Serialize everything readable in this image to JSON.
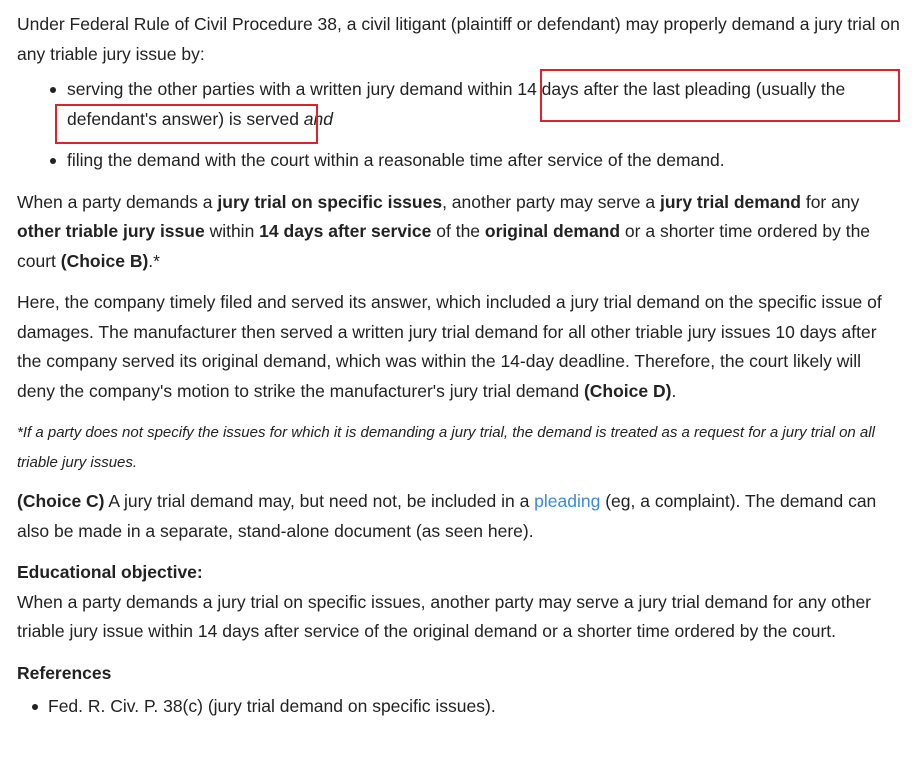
{
  "intro": "Under Federal Rule of Civil Procedure 38, a civil litigant (plaintiff or defendant) may properly demand a jury trial on any triable jury issue by:",
  "bullets": {
    "b1_text": "serving the other parties with a written jury demand within 14 days after the last pleading (usually the defendant's answer) is served ",
    "b1_and": "and",
    "b2_text": "filing the demand with the court within a reasonable time after service of the demand."
  },
  "para1": {
    "t1": "When a party demands a ",
    "b1": "jury trial on specific issues",
    "t2": ", another party may serve a ",
    "b2": "jury trial demand",
    "t3": " for any ",
    "b3": "other triable jury issue",
    "t4": " within ",
    "b4": "14 days after service",
    "t5": " of the ",
    "b5": "original demand",
    "t6": " or a shorter time ordered by the court ",
    "b6": "(Choice B)",
    "t7": ".*"
  },
  "para2": {
    "text": "Here, the company timely filed and served its answer, which included a jury trial demand on the specific issue of damages.  The manufacturer then served a written jury trial demand for all other triable jury issues 10 days after the company served its original demand, which was within the 14-day deadline.  Therefore, the court likely will deny the company's motion to strike the manufacturer's jury trial demand ",
    "choice": "(Choice D)",
    "end": "."
  },
  "footnote": "*If a party does not specify the issues for which it is demanding a jury trial, the demand is treated as a request for a jury trial on all triable jury issues.",
  "para3": {
    "choice": "(Choice C)",
    "t1": "  A jury trial demand may, but need not, be included in a ",
    "link": "pleading",
    "t2": " (eg, a complaint).  The demand can also be made in a separate, stand-alone document (as seen here)."
  },
  "objective": {
    "title": "Educational objective:",
    "text": "When a party demands a jury trial on specific issues, another party may serve a jury trial demand for any other triable jury issue within 14 days after service of the original demand or a shorter time ordered by the court."
  },
  "references": {
    "title": "References",
    "items": [
      "Fed. R. Civ. P. 38(c) (jury trial demand on specific issues)."
    ]
  },
  "colors": {
    "text": "#222222",
    "link": "#3a8bd6",
    "highlight_box": "#d9232d"
  }
}
